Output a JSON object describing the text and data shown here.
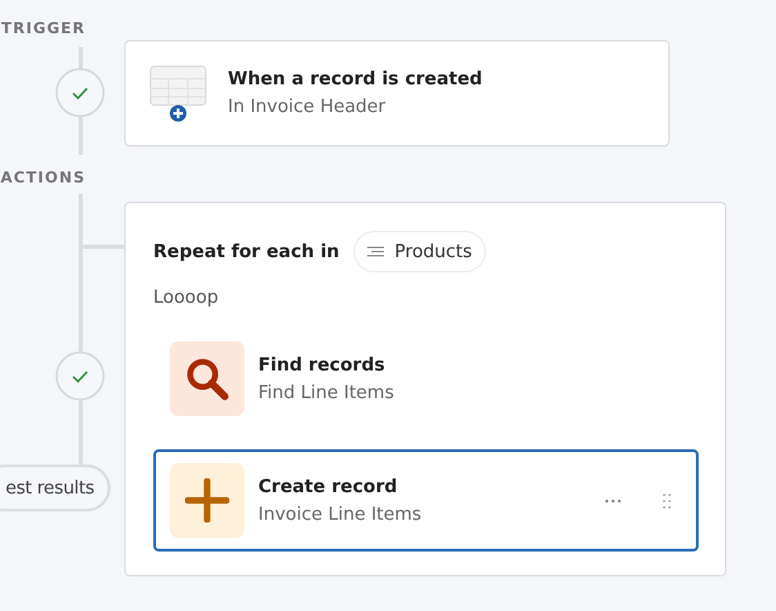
{
  "trigger": {
    "label": "TRIGGER",
    "title": "When a record is created",
    "subtitle": "In Invoice Header"
  },
  "actions": {
    "label": "ACTIONS",
    "loop": {
      "prefix": "Repeat for each in",
      "collection": "Products",
      "name": "Loooop"
    },
    "steps": [
      {
        "kind": "find",
        "title": "Find records",
        "subtitle": "Find Line Items",
        "selected": false
      },
      {
        "kind": "create",
        "title": "Create record",
        "subtitle": "Invoice Line Items",
        "selected": true
      }
    ]
  },
  "test_button": "est results"
}
